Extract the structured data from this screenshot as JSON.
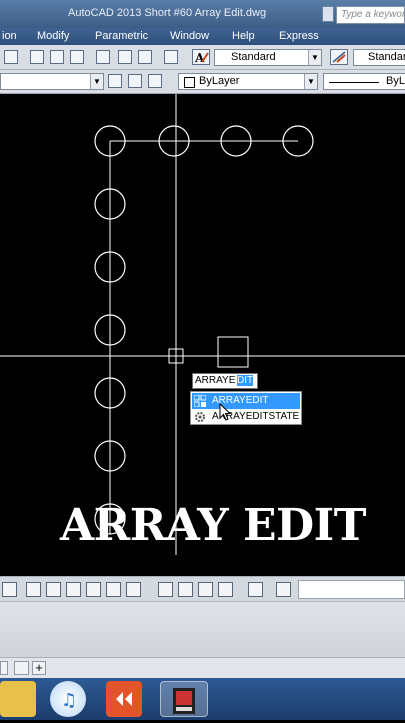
{
  "window": {
    "title": "AutoCAD 2013    Short #60 Array Edit.dwg",
    "search_placeholder": "Type a keywor"
  },
  "menu": {
    "items": [
      "ion",
      "Modify",
      "Parametric",
      "Window",
      "Help",
      "Express"
    ]
  },
  "toolbar": {
    "text_style": "Standard",
    "dim_style": "Standard",
    "layer_color": "ByLayer",
    "linetype": "ByL"
  },
  "command": {
    "typed": "ARRAYE",
    "autocomplete_highlight": "DIT",
    "suggestions": [
      "ARRAYEDIT",
      "ARRAYEDITSTATE"
    ]
  },
  "overlay": {
    "caption": "ARRAY EDIT"
  },
  "colors": {
    "titlebar": "#4a6f9c",
    "menubar": "#2f507d",
    "drawing_background": "#000000",
    "selection": "#3399ff",
    "taskbar": "#1f4a85"
  },
  "icons": [
    "layer-properties-icon",
    "text-style-icon",
    "dimension-style-icon",
    "array-edit-icon",
    "gear-icon",
    "itunes-icon",
    "media-player-icon",
    "autocad-taskbar-icon",
    "folder-icon"
  ]
}
